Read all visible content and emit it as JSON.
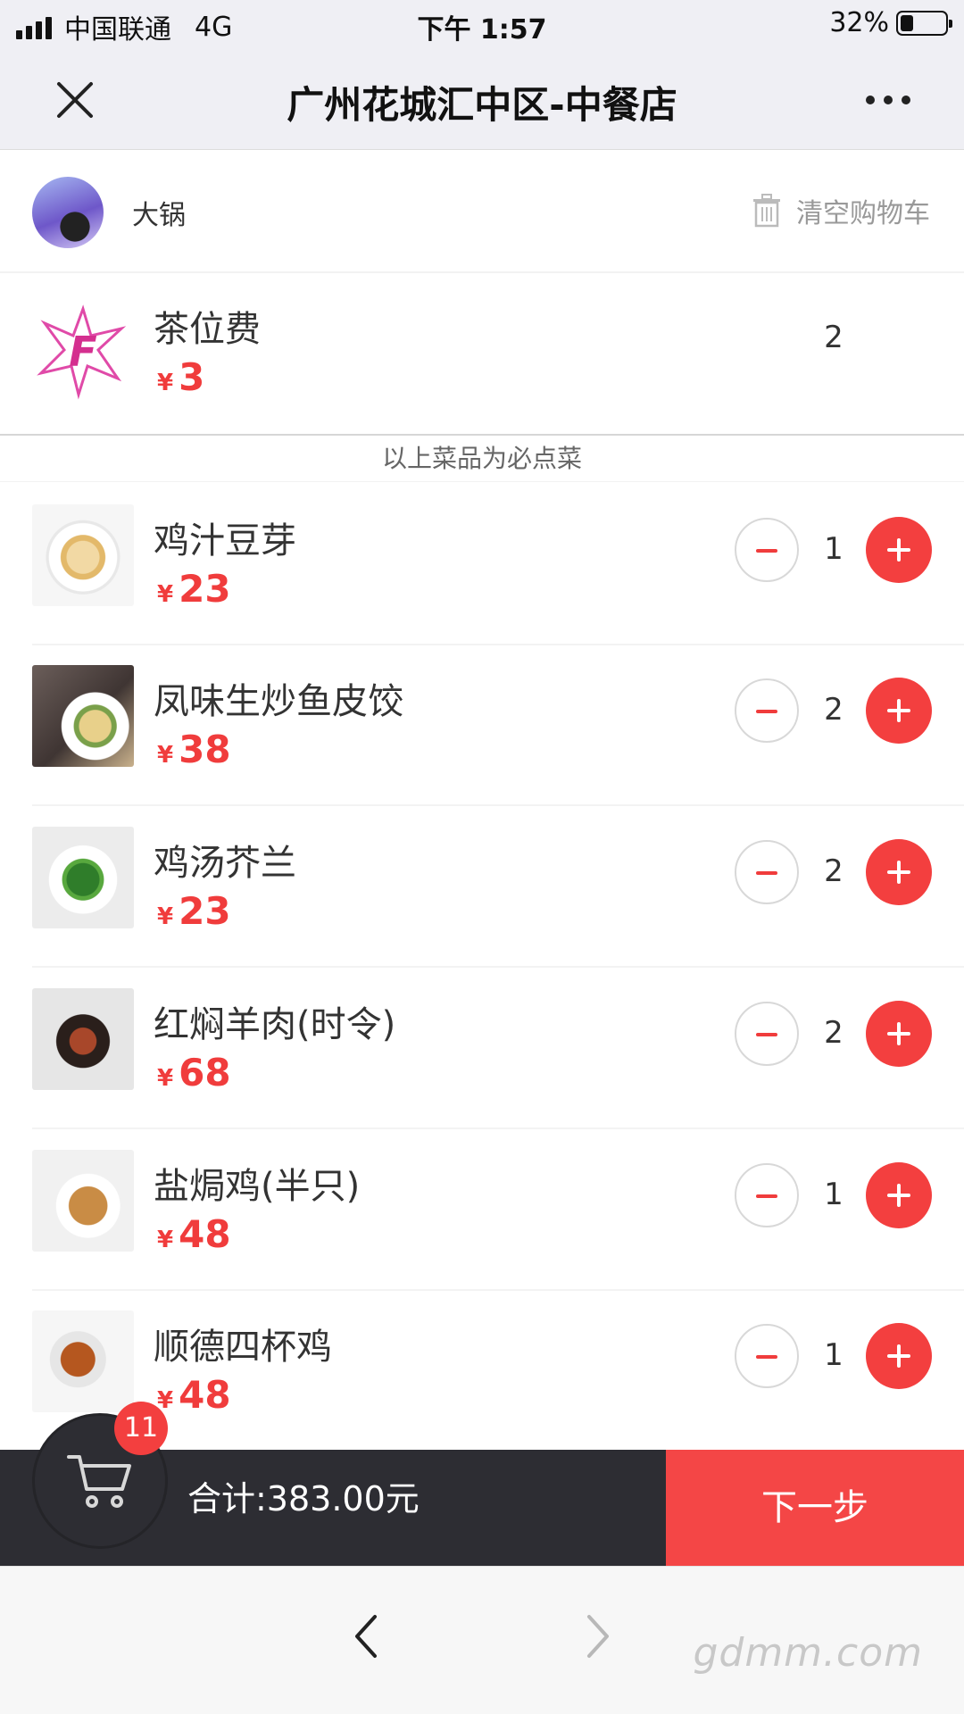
{
  "status_bar": {
    "carrier": "中国联通",
    "network": "4G",
    "time": "下午 1:57",
    "battery": "32%",
    "battery_level": 0.32
  },
  "nav": {
    "title": "广州花城汇中区-中餐店",
    "close_icon": "close-icon",
    "more_icon": "more-dots-icon"
  },
  "user": {
    "name": "大锅",
    "clear_cart_label": "清空购物车"
  },
  "required_item": {
    "name": "茶位费",
    "currency": "¥",
    "price": "3",
    "qty": "2"
  },
  "required_note": "以上菜品为必点菜",
  "items": [
    {
      "name": "鸡汁豆芽",
      "currency": "¥",
      "price": "23",
      "qty": "1"
    },
    {
      "name": "凤味生炒鱼皮饺",
      "currency": "¥",
      "price": "38",
      "qty": "2"
    },
    {
      "name": "鸡汤芥兰",
      "currency": "¥",
      "price": "23",
      "qty": "2"
    },
    {
      "name": "红焖羊肉(时令)",
      "currency": "¥",
      "price": "68",
      "qty": "2"
    },
    {
      "name": "盐焗鸡(半只)",
      "currency": "¥",
      "price": "48",
      "qty": "1"
    },
    {
      "name": "顺德四杯鸡",
      "currency": "¥",
      "price": "48",
      "qty": "1"
    }
  ],
  "cart": {
    "count": "11",
    "total_label": "合计:383.00元",
    "next_label": "下一步"
  },
  "watermark": "gdmm.com",
  "colors": {
    "accent": "#f33f3f",
    "cart_bar": "#2d2d33",
    "price": "#f03c3c"
  }
}
